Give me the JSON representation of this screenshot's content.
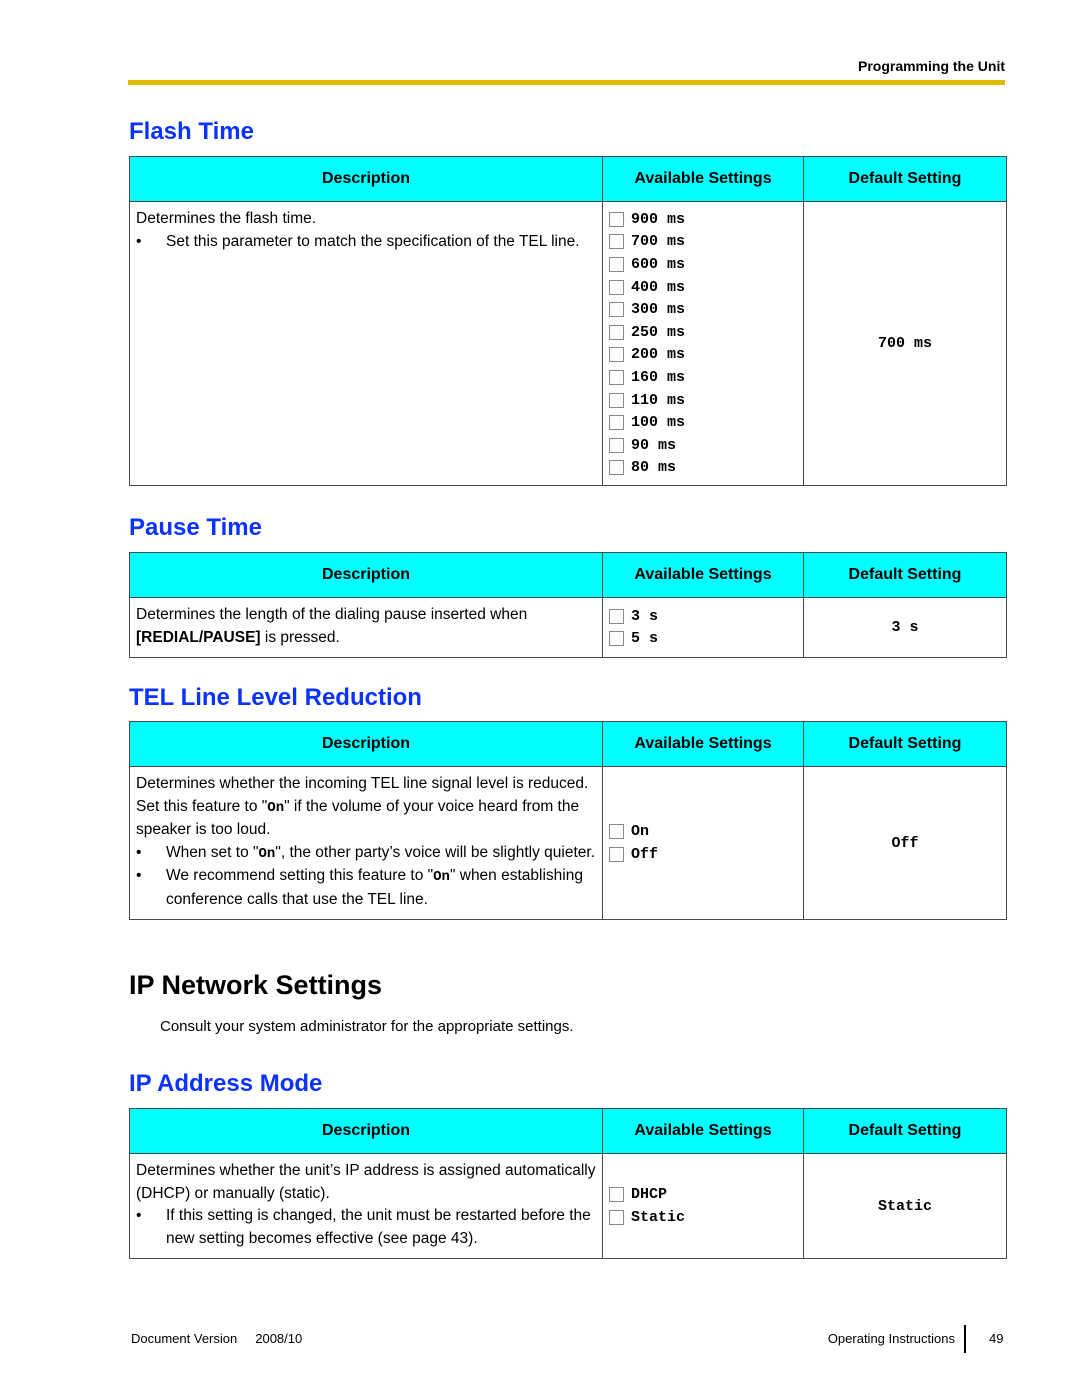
{
  "header": {
    "section_label": "Programming the Unit",
    "colors": {
      "rule": "#e0b800",
      "section_title": "#0b32ff",
      "table_header": "#00ffff"
    }
  },
  "table_headers": {
    "description": "Description",
    "available": "Available Settings",
    "default": "Default Setting"
  },
  "flash_time": {
    "title": "Flash Time",
    "description": "Determines the flash time.",
    "bullets": [
      "Set this parameter to match the specification of the TEL line."
    ],
    "options": [
      "900 ms",
      "700 ms",
      "600 ms",
      "400 ms",
      "300 ms",
      "250 ms",
      "200 ms",
      "160 ms",
      "110 ms",
      "100 ms",
      "90 ms",
      "80 ms"
    ],
    "default": "700 ms"
  },
  "pause_time": {
    "title": "Pause Time",
    "description_pre": "Determines the length of the dialing pause inserted when ",
    "description_key": "[REDIAL/PAUSE]",
    "description_post": " is pressed.",
    "options": [
      "3 s",
      "5 s"
    ],
    "default": "3 s"
  },
  "tel_line_level": {
    "title": "TEL Line Level Reduction",
    "desc_part1": "Determines whether the incoming TEL line signal level is reduced. Set this feature to \"",
    "desc_code1": "On",
    "desc_part2": "\" if the volume of your voice heard from the speaker is too loud.",
    "bullet1_pre": "When set to \"",
    "bullet1_code": "On",
    "bullet1_post": "\", the other party’s voice will be slightly quieter.",
    "bullet2_pre": "We recommend setting this feature to \"",
    "bullet2_code": "On",
    "bullet2_post": "\" when establishing conference calls that use the TEL line.",
    "options": [
      "On",
      "Off"
    ],
    "default": "Off"
  },
  "ip_network": {
    "title": "IP Network Settings",
    "intro": "Consult your system administrator for the appropriate settings."
  },
  "ip_address_mode": {
    "title": "IP Address Mode",
    "description": "Determines whether the unit’s IP address is assigned automatically (DHCP) or manually (static).",
    "bullets": [
      "If this setting is changed, the unit must be restarted before the new setting becomes effective (see page 43)."
    ],
    "options": [
      "DHCP",
      "Static"
    ],
    "default": "Static"
  },
  "footer": {
    "doc_version_label": "Document Version",
    "doc_version": "2008/10",
    "manual_name": "Operating Instructions",
    "page_number": "49"
  }
}
